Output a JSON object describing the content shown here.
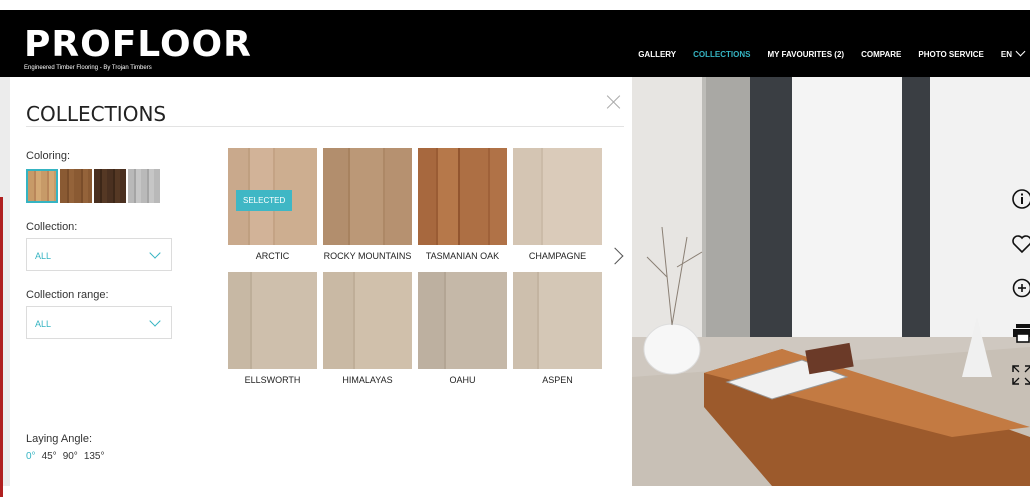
{
  "header": {
    "logo": "PROFLOOR",
    "tagline": "Engineered Timber Flooring - By Trojan Timbers",
    "nav": [
      {
        "label": "GALLERY",
        "active": false
      },
      {
        "label": "COLLECTIONS",
        "active": true
      },
      {
        "label": "MY FAVOURITES (2)",
        "active": false
      },
      {
        "label": "COMPARE",
        "active": false
      },
      {
        "label": "PHOTO SERVICE",
        "active": false
      }
    ],
    "language": "EN"
  },
  "panel": {
    "title": "COLLECTIONS",
    "coloring_label": "Coloring:",
    "coloring_swatches": [
      {
        "name": "light-oak",
        "color": "#c79a68",
        "selected": true
      },
      {
        "name": "medium-brown",
        "color": "#8a5a33",
        "selected": false
      },
      {
        "name": "dark-brown",
        "color": "#4a3020",
        "selected": false
      },
      {
        "name": "grey",
        "color": "#b9b9b9",
        "selected": false
      }
    ],
    "collection_label": "Collection:",
    "collection_value": "ALL",
    "range_label": "Collection range:",
    "range_value": "ALL",
    "products": [
      {
        "name": "ARCTIC",
        "color": "#c9a98c",
        "selected": true
      },
      {
        "name": "ROCKY MOUNTAINS",
        "color": "#b28e6d",
        "selected": false
      },
      {
        "name": "TASMANIAN OAK",
        "color": "#a7683e",
        "selected": false
      },
      {
        "name": "CHAMPAGNE",
        "color": "#d4c5b3",
        "selected": false
      },
      {
        "name": "ELLSWORTH",
        "color": "#c7b8a4",
        "selected": false
      },
      {
        "name": "HIMALAYAS",
        "color": "#c9b9a4",
        "selected": false
      },
      {
        "name": "OAHU",
        "color": "#bdb0a0",
        "selected": false
      },
      {
        "name": "ASPEN",
        "color": "#cdbfad",
        "selected": false
      }
    ],
    "selected_badge": "SELECTED",
    "laying_angle_label": "Laying Angle:",
    "angles": [
      "0°",
      "45°",
      "90°",
      "135°"
    ],
    "active_angle": "0°"
  },
  "toolbar_icons": [
    "info-icon",
    "heart-icon",
    "zoom-in-icon",
    "print-icon",
    "fullscreen-icon"
  ]
}
